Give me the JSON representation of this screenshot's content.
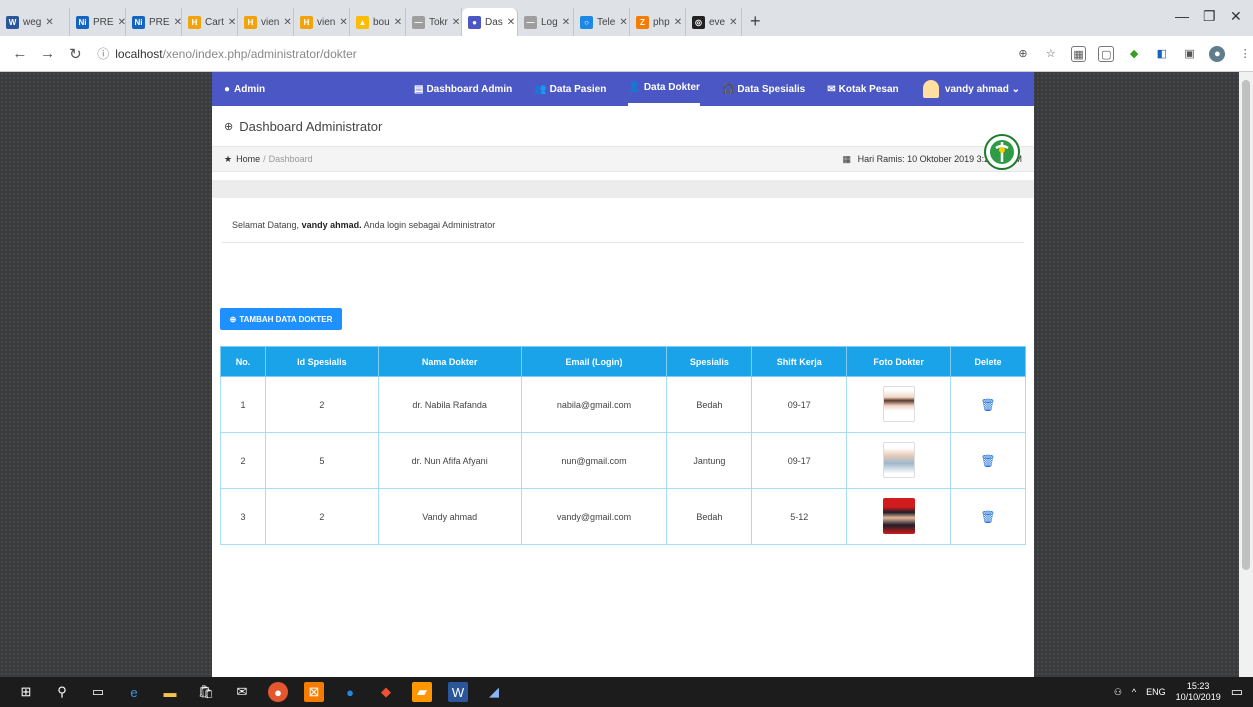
{
  "browser": {
    "tabs": [
      {
        "icon": "W",
        "title": "weg",
        "color": "#2b579a"
      },
      {
        "icon": "Ni",
        "title": "PRE",
        "color": "#1565c0"
      },
      {
        "icon": "Ni",
        "title": "PRE",
        "color": "#1565c0"
      },
      {
        "icon": "H",
        "title": "Cart",
        "color": "#f0a30a"
      },
      {
        "icon": "H",
        "title": "vien",
        "color": "#f0a30a"
      },
      {
        "icon": "H",
        "title": "vien",
        "color": "#f0a30a"
      },
      {
        "icon": "▲",
        "title": "bou",
        "color": "#fbbc04"
      },
      {
        "icon": "—",
        "title": "Tokr",
        "color": "#9e9e9e"
      },
      {
        "icon": "●",
        "title": "Das",
        "color": "#4b57c4",
        "active": true
      },
      {
        "icon": "—",
        "title": "Log",
        "color": "#9e9e9e"
      },
      {
        "icon": "○",
        "title": "Tele",
        "color": "#1e88e5"
      },
      {
        "icon": "Z",
        "title": "php",
        "color": "#f57c00"
      },
      {
        "icon": "◎",
        "title": "eve",
        "color": "#222222"
      }
    ],
    "url_host": "localhost",
    "url_path": "/xeno/index.php/administrator/dokter"
  },
  "app": {
    "brand": "Admin",
    "nav": [
      {
        "label": "Dashboard Admin",
        "icon": "▤"
      },
      {
        "label": "Data Pasien",
        "icon": "👥"
      },
      {
        "label": "Data Dokter",
        "icon": "👤",
        "active": true
      },
      {
        "label": "Data Spesialis",
        "icon": "🎧"
      },
      {
        "label": "Kotak Pesan",
        "icon": "✉"
      }
    ],
    "user": "vandy ahmad ⌄"
  },
  "header": {
    "title": "Dashboard Administrator",
    "breadcrumb_home": "Home",
    "breadcrumb_current": "Dashboard",
    "date": "Hari Ramis: 10 Oktober 2019 3:22:11 PM"
  },
  "welcome": {
    "prefix": "Selamat Datang,",
    "name": "vandy ahmad.",
    "suffix": "Anda login sebagai Administrator"
  },
  "add_button": "TAMBAH DATA DOKTER",
  "table": {
    "headers": [
      "No.",
      "Id Spesialis",
      "Nama Dokter",
      "Email (Login)",
      "Spesialis",
      "Shift Kerja",
      "Foto Dokter",
      "Delete"
    ],
    "rows": [
      {
        "no": "1",
        "id": "2",
        "nama": "dr. Nabila Rafanda",
        "email": "nabila@gmail.com",
        "spesialis": "Bedah",
        "shift": "09-17",
        "foto": "p1"
      },
      {
        "no": "2",
        "id": "5",
        "nama": "dr. Nun Afifa Afyani",
        "email": "nun@gmail.com",
        "spesialis": "Jantung",
        "shift": "09-17",
        "foto": "p2"
      },
      {
        "no": "3",
        "id": "2",
        "nama": "Vandy ahmad",
        "email": "vandy@gmail.com",
        "spesialis": "Bedah",
        "shift": "5-12",
        "foto": "p3"
      }
    ]
  },
  "taskbar": {
    "lang": "ENG",
    "time": "15:23",
    "date": "10/10/2019"
  }
}
